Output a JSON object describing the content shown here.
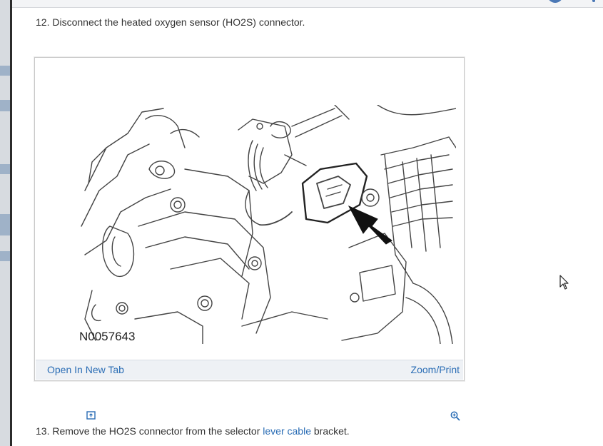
{
  "steps": [
    {
      "number": "12.",
      "text": "Disconnect the heated oxygen sensor (HO2S) connector."
    },
    {
      "number": "13.",
      "text_before": "Remove the HO2S connector from the selector",
      "link_text": "lever cable",
      "text_after": "bracket."
    }
  ],
  "figure": {
    "image_label": "N0057643",
    "open_label": "Open In New Tab",
    "zoom_label": "Zoom/Print",
    "open_icon": "open-in-new-tab-icon",
    "zoom_icon": "magnifier-zoom-icon"
  },
  "colors": {
    "link": "#2a6db5",
    "footer_bg": "#eef1f5",
    "text": "#333333"
  }
}
